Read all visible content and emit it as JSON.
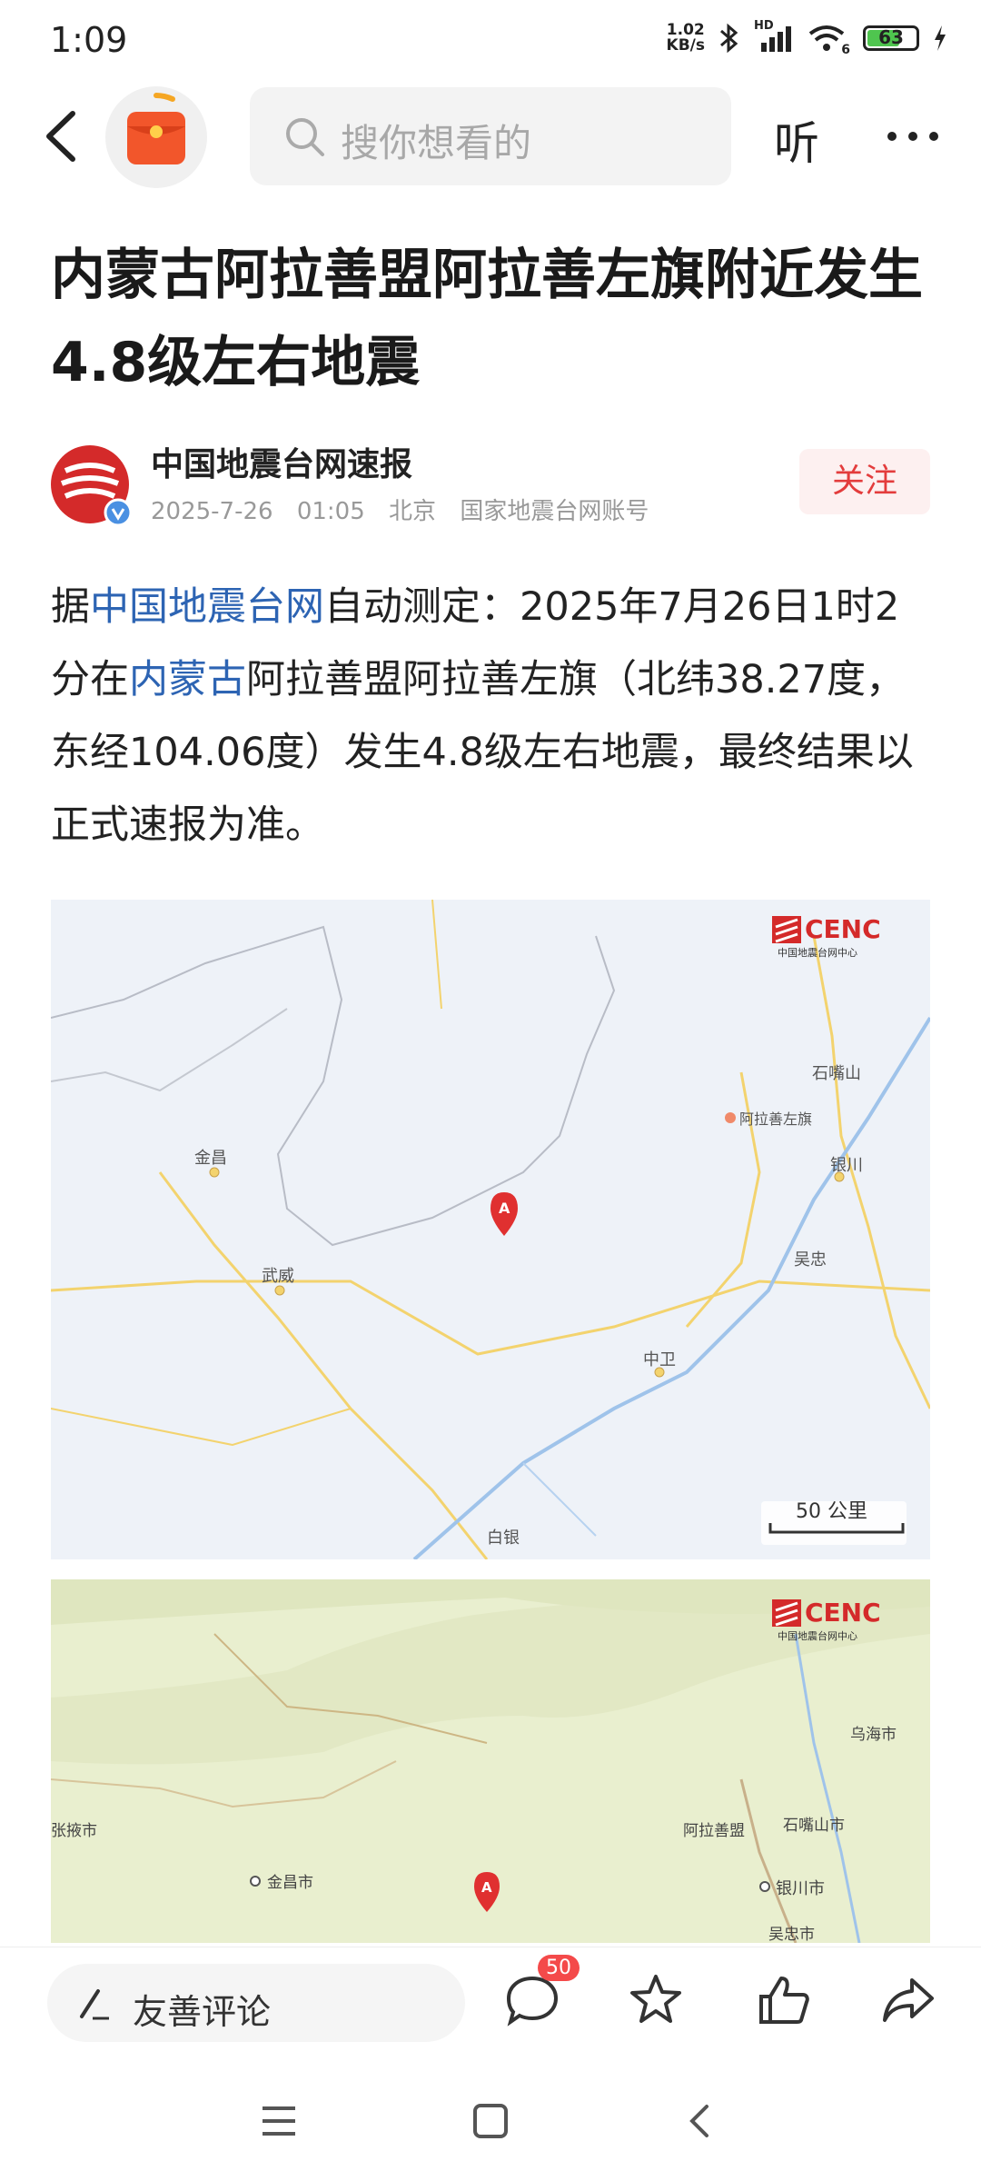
{
  "status_bar": {
    "time": "1:09",
    "net_speed_value": "1.02",
    "net_speed_unit": "KB/s",
    "battery": "63",
    "signal_label": "HD",
    "wifi_label": "6"
  },
  "top_bar": {
    "search_placeholder": "搜你想看的",
    "listen_label": "听"
  },
  "article": {
    "title": "内蒙古阿拉善盟阿拉善左旗附近发生4.8级左右地震",
    "author": "中国地震台网速报",
    "date": "2025-7-26",
    "time": "01:05",
    "location": "北京",
    "account_type": "国家地震台网账号",
    "follow_label": "关注",
    "body_1": "据",
    "body_link_1": "中国地震台网",
    "body_2": "自动测定：2025年7月26日1时2分在",
    "body_link_2": "内蒙古",
    "body_3": "阿拉善盟阿拉善左旗（北纬38.27度，东经104.06度）发生4.8级左右地震，最终结果以正式速报为准。"
  },
  "map1": {
    "logo_text": "CENC",
    "logo_sub": "中国地震台网中心",
    "scale_label": "50 公里",
    "epicenter_marker": "A",
    "places": [
      "石嘴山",
      "阿拉善左旗",
      "银川",
      "吴忠",
      "中卫",
      "金昌",
      "武威",
      "白银"
    ]
  },
  "map2": {
    "logo_text": "CENC",
    "logo_sub": "中国地震台网中心",
    "epicenter_marker": "A",
    "places": [
      "乌海市",
      "阿拉善盟",
      "石嘴山市",
      "银川市",
      "张掖市",
      "金昌市",
      "吴忠市"
    ]
  },
  "action_bar": {
    "comment_placeholder": "友善评论",
    "comment_count": "50"
  },
  "colors": {
    "accent_red": "#e33c3c",
    "link_blue": "#2d64b3",
    "map1_bg": "#eef2f8",
    "map2_bg": "#e9efcf"
  }
}
